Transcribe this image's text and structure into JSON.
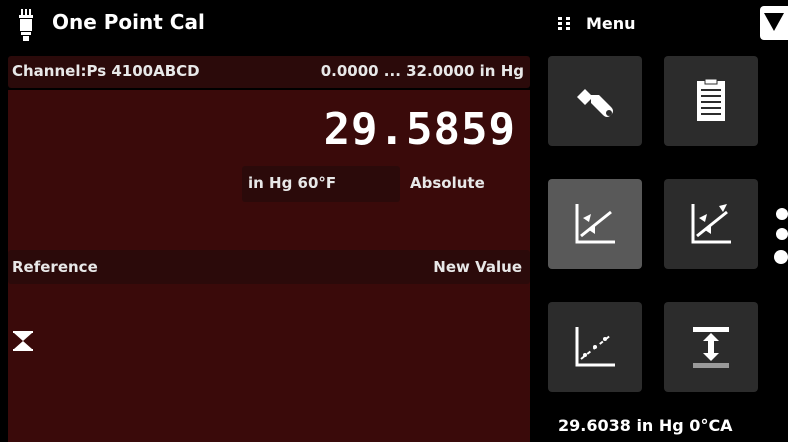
{
  "header": {
    "title": "One Point Cal"
  },
  "channel": {
    "name": "Channel:Ps 4100ABCD",
    "range": "0.0000 ... 32.0000 in Hg"
  },
  "reading": {
    "value": "29.5859",
    "unit": "in Hg 60°F",
    "mode": "Absolute"
  },
  "reference": {
    "label": "Reference",
    "new_value_label": "New Value"
  },
  "menu": {
    "label": "Menu",
    "tiles": [
      "wrench-icon",
      "clipboard-icon",
      "cal-point-icon",
      "cal-multi-icon",
      "linearization-icon",
      "zero-icon"
    ],
    "active_tile": 2
  },
  "pages": {
    "count": 3,
    "current": 3
  },
  "status": {
    "barometer": "29.6038 in Hg 0°CA"
  },
  "colors": {
    "panel": "#3a0a0a",
    "bar": "#2b0a0a",
    "tile": "#2c2c2c",
    "tile_active": "#595959"
  }
}
